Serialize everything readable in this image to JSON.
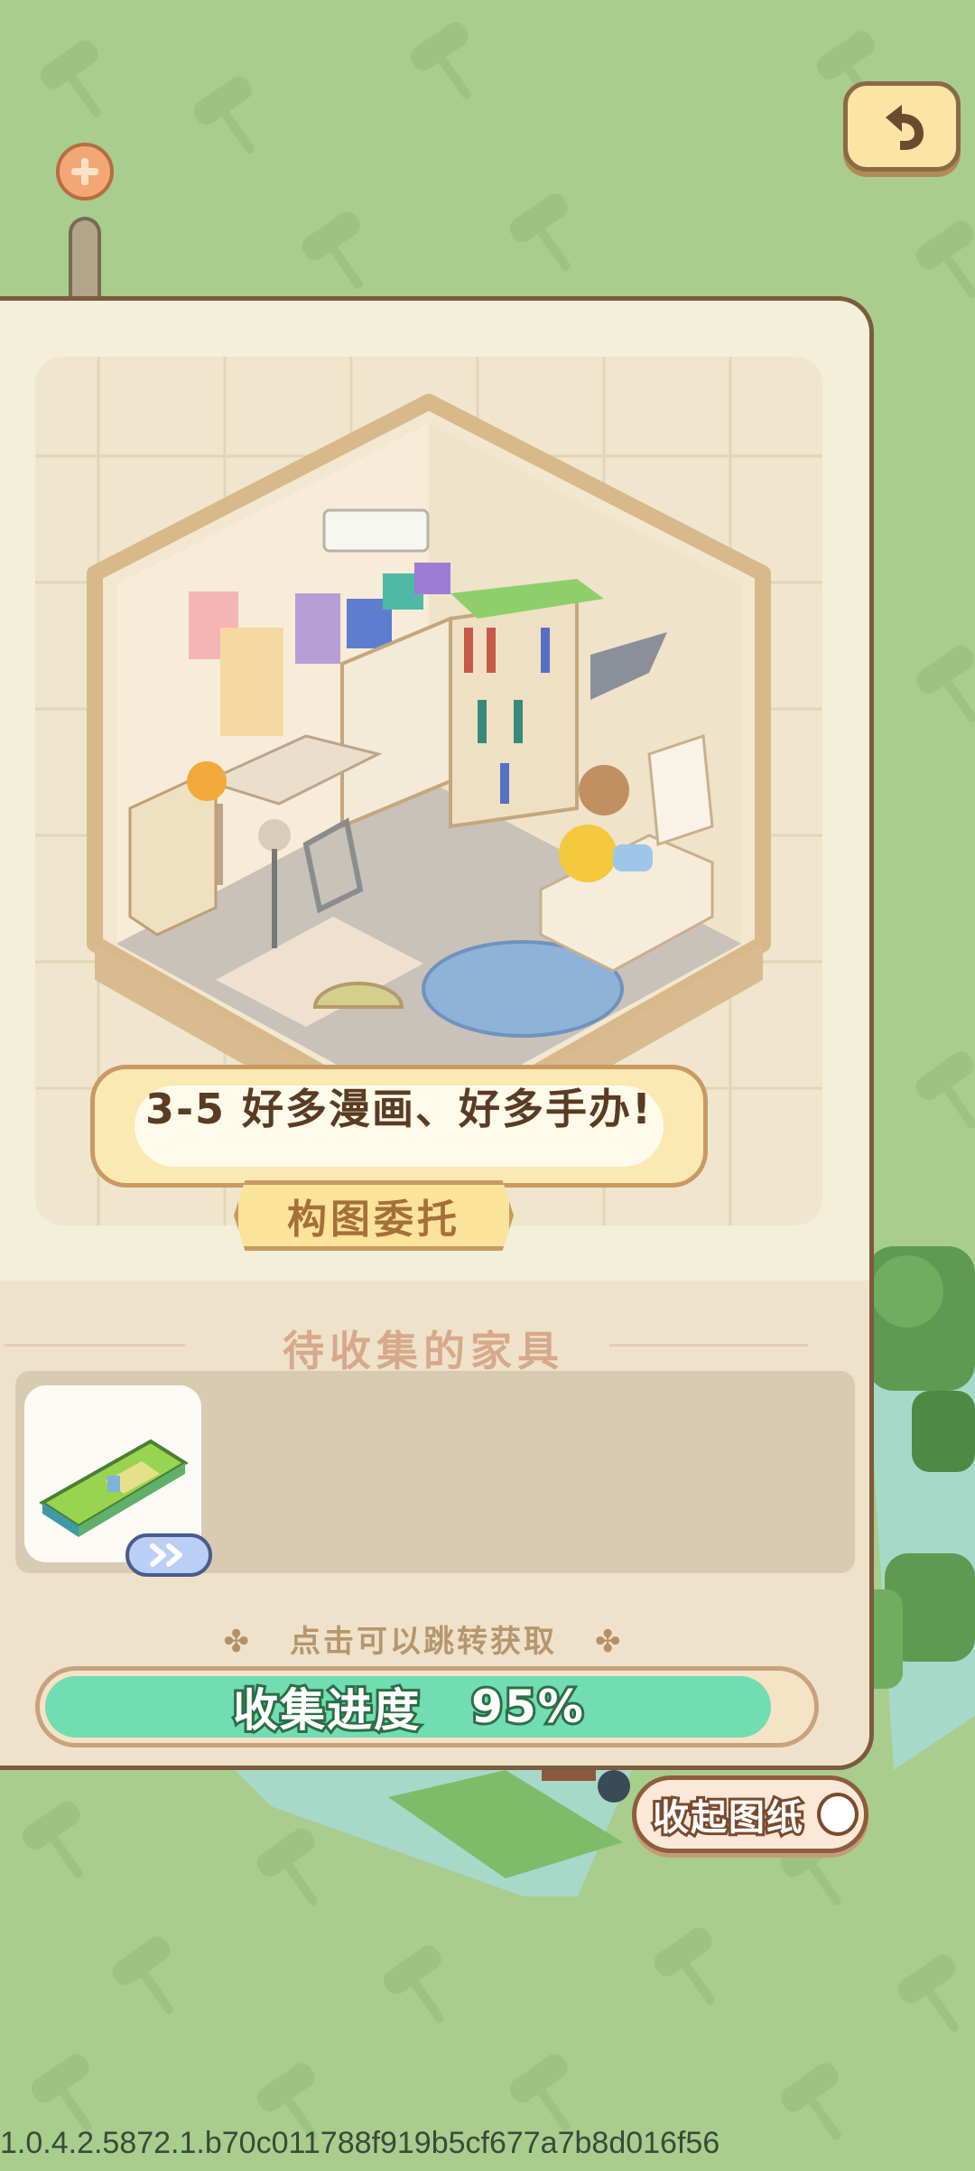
{
  "room": {
    "title": "3-5 好多漫画、好多手办!",
    "tag_label": "构图委托"
  },
  "furniture_section": {
    "heading": "待收集的家具",
    "items": [
      {
        "icon": "green-cushion-furniture-icon",
        "badge_icon": "double-chevron-right-icon"
      }
    ],
    "hint": "点击可以跳转获取"
  },
  "progress": {
    "label": "收集进度",
    "percent_text": "95%",
    "value": 0.95
  },
  "fold_button": {
    "label": "收起图纸"
  },
  "back_button": {
    "icon": "undo-arrow-icon"
  },
  "zoom": {
    "icon": "plus-icon"
  },
  "version_text": "1.0.4.2.5872.1.b70c011788f919b5cf677a7b8d016f56",
  "colors": {
    "background": "#a8cd8d",
    "panel": "#f3efd9",
    "progress_fill": "#72dcb2",
    "accent_brown": "#7c5a3c"
  }
}
